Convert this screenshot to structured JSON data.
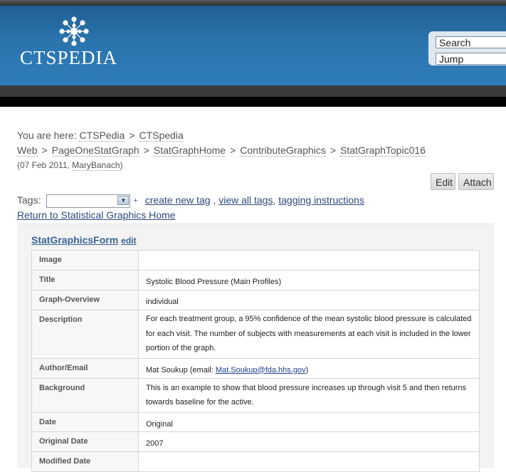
{
  "header": {
    "logo_text": "CTSPEDIA",
    "search_placeholder": "Search",
    "jump_placeholder": "Jump"
  },
  "breadcrumb": {
    "prefix": "You are here:",
    "items": [
      "CTSPedia",
      "CTSpedia Web",
      "PageOneStatGraph",
      "StatGraphHome",
      "ContributeGraphics",
      "StatGraphTopic016"
    ],
    "revision_date": "07 Feb 2011",
    "revision_author": "MaryBanach"
  },
  "toolbar": {
    "edit_label": "Edit",
    "attach_label": "Attach"
  },
  "tags": {
    "label": "Tags:",
    "selected": "",
    "create_label": "create new tag",
    "view_all_label": "view all tags",
    "instructions_label": "tagging instructions"
  },
  "return_link": "Return to Statistical Graphics Home",
  "form": {
    "title": "StatGraphicsForm",
    "edit_label": "edit",
    "rows": [
      {
        "label": "Image",
        "value": ""
      },
      {
        "label": "Title",
        "value": "Systolic Blood Pressure (Main Profiles)"
      },
      {
        "label": "Graph-Overview",
        "value": "individual"
      },
      {
        "label": "Description",
        "value": "For each treatment group, a 95% confidence of the mean systolic blood pressure is calculated for each visit. The number of subjects with measurements at each visit is included in the lower portion of the graph."
      },
      {
        "label": "Author/Email",
        "value_prefix": "Mat Soukup (email: ",
        "email": "Mat.Soukup@fda.hhs.gov",
        "value_suffix": ")"
      },
      {
        "label": "Background",
        "value": "This is an example to show that blood pressure increases up through visit 5 and then returns towards baseline for the active."
      },
      {
        "label": "Date",
        "value": "Original"
      },
      {
        "label": "Original Date",
        "value": "2007"
      },
      {
        "label": "Modified Date",
        "value": ""
      }
    ]
  }
}
